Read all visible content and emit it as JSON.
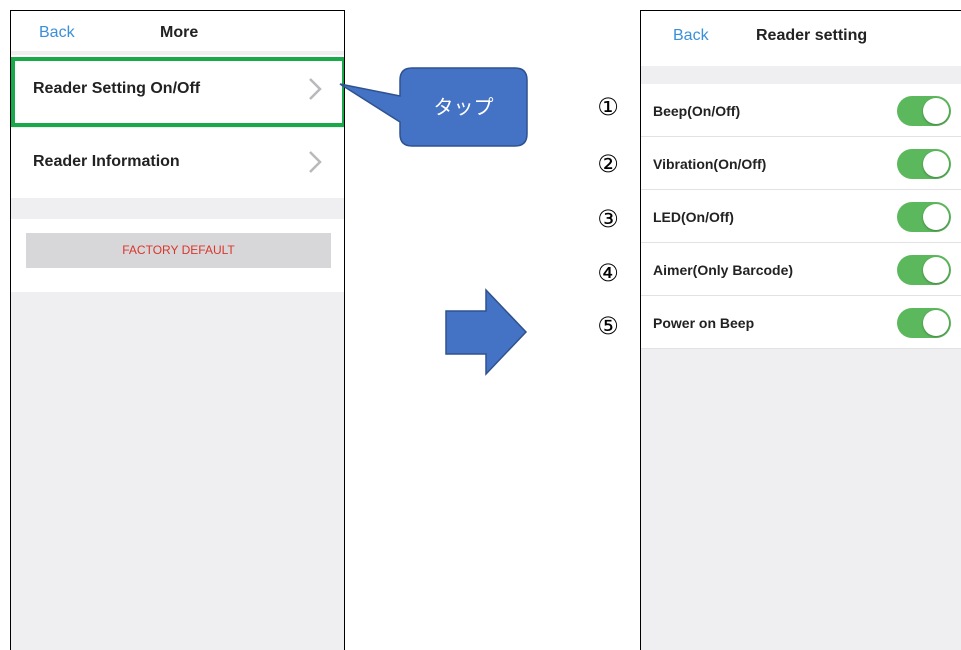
{
  "left_screen": {
    "nav": {
      "back": "Back",
      "title": "More"
    },
    "menu": [
      {
        "label": "Reader Setting On/Off"
      },
      {
        "label": "Reader Information"
      }
    ],
    "factory_default": "FACTORY DEFAULT"
  },
  "callout": {
    "text": "タップ"
  },
  "right_screen": {
    "nav": {
      "back": "Back",
      "title": "Reader setting"
    },
    "toggles": [
      {
        "number": "①",
        "label": "Beep(On/Off)",
        "on": true
      },
      {
        "number": "②",
        "label": "Vibration(On/Off)",
        "on": true
      },
      {
        "number": "③",
        "label": "LED(On/Off)",
        "on": true
      },
      {
        "number": "④",
        "label": "Aimer(Only Barcode)",
        "on": true
      },
      {
        "number": "⑤",
        "label": "Power on Beep",
        "on": true
      }
    ]
  },
  "colors": {
    "link_blue": "#3a8fd9",
    "highlight_green": "#19a84a",
    "callout_blue": "#4472c4",
    "switch_green": "#5cb85c",
    "factory_red": "#d9362b"
  }
}
